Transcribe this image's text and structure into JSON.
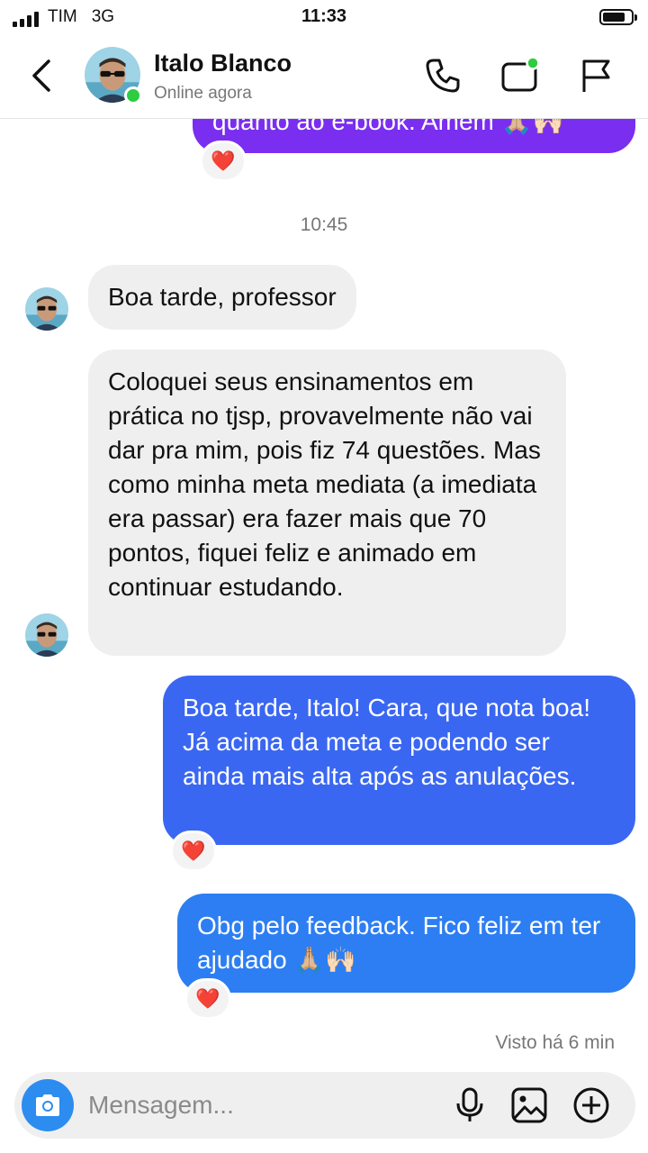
{
  "status_bar": {
    "carrier": "TIM",
    "network": "3G",
    "time": "11:33"
  },
  "header": {
    "name": "Italo Blanco",
    "status": "Online agora",
    "icons": [
      "back-icon",
      "phone-icon",
      "video-icon",
      "flag-icon"
    ]
  },
  "messages": {
    "partial_top": "quanto ao e-book. Amém 🙏🏼🙌🏻",
    "time_separator": "10:45",
    "in_1": "Boa tarde, professor",
    "in_2": "Coloquei seus ensinamentos em prática no tjsp, provavelmente não vai dar pra mim, pois fiz 74 questões. Mas como minha meta mediata (a imediata era passar) era fazer mais que 70 pontos, fiquei feliz e animado em continuar estudando.",
    "out_1": "Boa tarde, Italo! Cara, que nota boa! Já acima da meta e podendo ser ainda mais alta após as anulações.",
    "out_2": "Obg pelo feedback. Fico feliz em ter ajudado 🙏🏼🙌🏻",
    "reaction": "❤️",
    "seen": "Visto há 6 min"
  },
  "composer": {
    "placeholder": "Mensagem..."
  },
  "colors": {
    "partial_bubble": "#7a2ef0",
    "out_bubble_1": "#3a67f2",
    "out_bubble_2": "#2d7ef2",
    "incoming_bubble": "#efefef",
    "online": "#2ecc40",
    "camera_button": "#2d8cf0"
  }
}
